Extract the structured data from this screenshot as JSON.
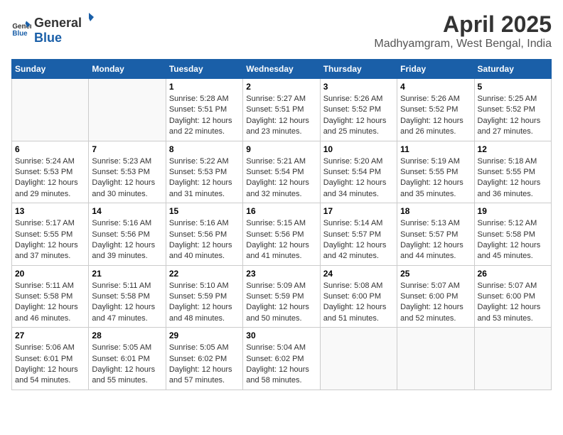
{
  "header": {
    "logo_general": "General",
    "logo_blue": "Blue",
    "month_title": "April 2025",
    "location": "Madhyamgram, West Bengal, India"
  },
  "days_of_week": [
    "Sunday",
    "Monday",
    "Tuesday",
    "Wednesday",
    "Thursday",
    "Friday",
    "Saturday"
  ],
  "weeks": [
    [
      {
        "day": "",
        "sunrise": "",
        "sunset": "",
        "daylight": ""
      },
      {
        "day": "",
        "sunrise": "",
        "sunset": "",
        "daylight": ""
      },
      {
        "day": "1",
        "sunrise": "Sunrise: 5:28 AM",
        "sunset": "Sunset: 5:51 PM",
        "daylight": "Daylight: 12 hours and 22 minutes."
      },
      {
        "day": "2",
        "sunrise": "Sunrise: 5:27 AM",
        "sunset": "Sunset: 5:51 PM",
        "daylight": "Daylight: 12 hours and 23 minutes."
      },
      {
        "day": "3",
        "sunrise": "Sunrise: 5:26 AM",
        "sunset": "Sunset: 5:52 PM",
        "daylight": "Daylight: 12 hours and 25 minutes."
      },
      {
        "day": "4",
        "sunrise": "Sunrise: 5:26 AM",
        "sunset": "Sunset: 5:52 PM",
        "daylight": "Daylight: 12 hours and 26 minutes."
      },
      {
        "day": "5",
        "sunrise": "Sunrise: 5:25 AM",
        "sunset": "Sunset: 5:52 PM",
        "daylight": "Daylight: 12 hours and 27 minutes."
      }
    ],
    [
      {
        "day": "6",
        "sunrise": "Sunrise: 5:24 AM",
        "sunset": "Sunset: 5:53 PM",
        "daylight": "Daylight: 12 hours and 29 minutes."
      },
      {
        "day": "7",
        "sunrise": "Sunrise: 5:23 AM",
        "sunset": "Sunset: 5:53 PM",
        "daylight": "Daylight: 12 hours and 30 minutes."
      },
      {
        "day": "8",
        "sunrise": "Sunrise: 5:22 AM",
        "sunset": "Sunset: 5:53 PM",
        "daylight": "Daylight: 12 hours and 31 minutes."
      },
      {
        "day": "9",
        "sunrise": "Sunrise: 5:21 AM",
        "sunset": "Sunset: 5:54 PM",
        "daylight": "Daylight: 12 hours and 32 minutes."
      },
      {
        "day": "10",
        "sunrise": "Sunrise: 5:20 AM",
        "sunset": "Sunset: 5:54 PM",
        "daylight": "Daylight: 12 hours and 34 minutes."
      },
      {
        "day": "11",
        "sunrise": "Sunrise: 5:19 AM",
        "sunset": "Sunset: 5:55 PM",
        "daylight": "Daylight: 12 hours and 35 minutes."
      },
      {
        "day": "12",
        "sunrise": "Sunrise: 5:18 AM",
        "sunset": "Sunset: 5:55 PM",
        "daylight": "Daylight: 12 hours and 36 minutes."
      }
    ],
    [
      {
        "day": "13",
        "sunrise": "Sunrise: 5:17 AM",
        "sunset": "Sunset: 5:55 PM",
        "daylight": "Daylight: 12 hours and 37 minutes."
      },
      {
        "day": "14",
        "sunrise": "Sunrise: 5:16 AM",
        "sunset": "Sunset: 5:56 PM",
        "daylight": "Daylight: 12 hours and 39 minutes."
      },
      {
        "day": "15",
        "sunrise": "Sunrise: 5:16 AM",
        "sunset": "Sunset: 5:56 PM",
        "daylight": "Daylight: 12 hours and 40 minutes."
      },
      {
        "day": "16",
        "sunrise": "Sunrise: 5:15 AM",
        "sunset": "Sunset: 5:56 PM",
        "daylight": "Daylight: 12 hours and 41 minutes."
      },
      {
        "day": "17",
        "sunrise": "Sunrise: 5:14 AM",
        "sunset": "Sunset: 5:57 PM",
        "daylight": "Daylight: 12 hours and 42 minutes."
      },
      {
        "day": "18",
        "sunrise": "Sunrise: 5:13 AM",
        "sunset": "Sunset: 5:57 PM",
        "daylight": "Daylight: 12 hours and 44 minutes."
      },
      {
        "day": "19",
        "sunrise": "Sunrise: 5:12 AM",
        "sunset": "Sunset: 5:58 PM",
        "daylight": "Daylight: 12 hours and 45 minutes."
      }
    ],
    [
      {
        "day": "20",
        "sunrise": "Sunrise: 5:11 AM",
        "sunset": "Sunset: 5:58 PM",
        "daylight": "Daylight: 12 hours and 46 minutes."
      },
      {
        "day": "21",
        "sunrise": "Sunrise: 5:11 AM",
        "sunset": "Sunset: 5:58 PM",
        "daylight": "Daylight: 12 hours and 47 minutes."
      },
      {
        "day": "22",
        "sunrise": "Sunrise: 5:10 AM",
        "sunset": "Sunset: 5:59 PM",
        "daylight": "Daylight: 12 hours and 48 minutes."
      },
      {
        "day": "23",
        "sunrise": "Sunrise: 5:09 AM",
        "sunset": "Sunset: 5:59 PM",
        "daylight": "Daylight: 12 hours and 50 minutes."
      },
      {
        "day": "24",
        "sunrise": "Sunrise: 5:08 AM",
        "sunset": "Sunset: 6:00 PM",
        "daylight": "Daylight: 12 hours and 51 minutes."
      },
      {
        "day": "25",
        "sunrise": "Sunrise: 5:07 AM",
        "sunset": "Sunset: 6:00 PM",
        "daylight": "Daylight: 12 hours and 52 minutes."
      },
      {
        "day": "26",
        "sunrise": "Sunrise: 5:07 AM",
        "sunset": "Sunset: 6:00 PM",
        "daylight": "Daylight: 12 hours and 53 minutes."
      }
    ],
    [
      {
        "day": "27",
        "sunrise": "Sunrise: 5:06 AM",
        "sunset": "Sunset: 6:01 PM",
        "daylight": "Daylight: 12 hours and 54 minutes."
      },
      {
        "day": "28",
        "sunrise": "Sunrise: 5:05 AM",
        "sunset": "Sunset: 6:01 PM",
        "daylight": "Daylight: 12 hours and 55 minutes."
      },
      {
        "day": "29",
        "sunrise": "Sunrise: 5:05 AM",
        "sunset": "Sunset: 6:02 PM",
        "daylight": "Daylight: 12 hours and 57 minutes."
      },
      {
        "day": "30",
        "sunrise": "Sunrise: 5:04 AM",
        "sunset": "Sunset: 6:02 PM",
        "daylight": "Daylight: 12 hours and 58 minutes."
      },
      {
        "day": "",
        "sunrise": "",
        "sunset": "",
        "daylight": ""
      },
      {
        "day": "",
        "sunrise": "",
        "sunset": "",
        "daylight": ""
      },
      {
        "day": "",
        "sunrise": "",
        "sunset": "",
        "daylight": ""
      }
    ]
  ]
}
